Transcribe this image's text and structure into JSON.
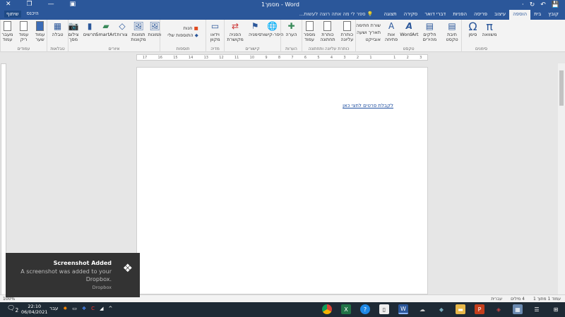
{
  "window": {
    "title": "מסמך1 - Word",
    "controls": {
      "close": "✕",
      "restore": "❐",
      "minimize": "—",
      "ribbon_options": "▣"
    }
  },
  "qat": {
    "save": "💾",
    "undo": "↶",
    "redo": "↻",
    "more": "·"
  },
  "tabs": [
    "קובץ",
    "בית",
    "הוספה",
    "עיצוב",
    "פריסה",
    "הפניות",
    "דברי דואר",
    "סקירה",
    "תצוגה"
  ],
  "active_tab": "הוספה",
  "tell_me": "ספר לי מה אתה רוצה לעשות...",
  "account": {
    "sign_in": "היכנס",
    "share": "שיתוף"
  },
  "ribbon": {
    "pages": {
      "label": "עמודים",
      "items": [
        "עמוד שער",
        "עמוד ריק",
        "מעבר עמוד"
      ]
    },
    "tables": {
      "label": "טבלאות",
      "items": [
        "טבלה"
      ]
    },
    "illustrations": {
      "label": "איורים",
      "items": [
        "תמונות",
        "תמונות מקוונות",
        "צורות",
        "SmartArt",
        "תרשים",
        "צילום מסך"
      ]
    },
    "addins": {
      "label": "תוספות",
      "items": [
        "חנות",
        "התוספות שלי"
      ]
    },
    "media": {
      "label": "מדיה",
      "items": [
        "וידאו מקוון"
      ]
    },
    "links": {
      "label": "קישורים",
      "items": [
        "היפר-קישור",
        "סימניה",
        "הפניה מקושרת"
      ]
    },
    "comments": {
      "label": "הערות",
      "items": [
        "הערה"
      ]
    },
    "header_footer": {
      "label": "כותרת עליונה ותחתונה",
      "items": [
        "כותרת עליונה",
        "כותרת תחתונה",
        "מספר עמוד"
      ]
    },
    "text": {
      "label": "טקסט",
      "items": [
        "תיבת טקסט",
        "חלקים מהירים",
        "WordArt",
        "אות פתיחה"
      ],
      "small": [
        "שורת חתימה",
        "תאריך ושעה",
        "אובייקט"
      ]
    },
    "symbols": {
      "label": "סימנים",
      "items": [
        "משוואה",
        "סימן"
      ]
    }
  },
  "ruler": {
    "ticks": [
      "3",
      "2",
      "1",
      "",
      "1",
      "2",
      "3",
      "4",
      "5",
      "6",
      "7",
      "8",
      "9",
      "10",
      "11",
      "12",
      "13",
      "14",
      "15",
      "16",
      "17"
    ]
  },
  "document": {
    "link_text": "לקבלת פרטים לחצי כאן"
  },
  "status": {
    "page": "עמוד 1 מתוך 1",
    "words": "4 מילים",
    "language": "עברית",
    "zoom": "100%"
  },
  "notification": {
    "title": "Screenshot Added",
    "body": "A screenshot was added to your Dropbox.",
    "source": "Dropbox"
  },
  "taskbar": {
    "time": "22:10",
    "date": "06/04/2021",
    "lang": "עבר",
    "notif_count": "2"
  }
}
